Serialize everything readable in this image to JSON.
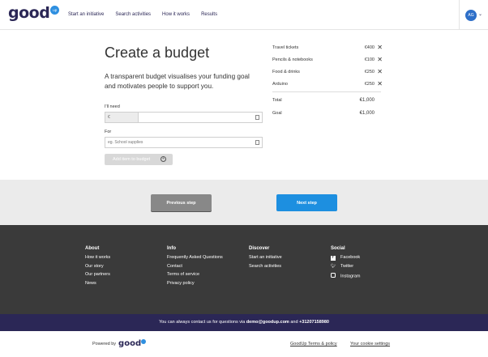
{
  "header": {
    "logo_text": "good",
    "logo_badge": "up",
    "nav": [
      "Start an initiative",
      "Search activities",
      "How it works",
      "Results"
    ],
    "avatar": "AG",
    "chevron": "⌄"
  },
  "form": {
    "title": "Create a budget",
    "lead": "A transparent budget visualises your funding goal and motivates people to support you.",
    "need_label": "I'll need",
    "currency": "€",
    "amount_value": "",
    "for_label": "For",
    "for_placeholder": "eg. School supplies",
    "add_button": "Add item to budget",
    "add_icon": "+"
  },
  "budget": {
    "items": [
      {
        "name": "Travel tickets",
        "amount": "€400"
      },
      {
        "name": "Pencils & notebooks",
        "amount": "€100"
      },
      {
        "name": "Food & drinks",
        "amount": "€250"
      },
      {
        "name": "Arduino",
        "amount": "€250"
      }
    ],
    "remove_icon": "✕",
    "total_label": "Total",
    "total_value": "€1,000",
    "goal_label": "Goal",
    "goal_value": "€1,000"
  },
  "steps": {
    "previous": "Previous step",
    "next": "Next step"
  },
  "footer": {
    "about": {
      "title": "About",
      "links": [
        "How it works",
        "Our story",
        "Our partners",
        "News"
      ]
    },
    "info": {
      "title": "Info",
      "links": [
        "Frequently Asked Questions",
        "Contact",
        "Terms of service",
        "Privacy policy"
      ]
    },
    "discover": {
      "title": "Discover",
      "links": [
        "Start an initiative",
        "Search activities"
      ]
    },
    "social": {
      "title": "Social",
      "links": [
        "Facebook",
        "Twitter",
        "Instagram"
      ]
    }
  },
  "contact": {
    "prefix": "You can always contact us for questions via",
    "email": "demo@goodup.com",
    "and": "and",
    "phone": "+31207158980"
  },
  "bottom": {
    "powered_by": "Powered by",
    "mini_logo": "good",
    "terms": "GoodUp Terms & policy",
    "cookies": "Your cookie settings"
  },
  "colors": {
    "brand": "#2b2756",
    "accent": "#1d8fe0",
    "footer_bg": "#3a3a3a"
  }
}
